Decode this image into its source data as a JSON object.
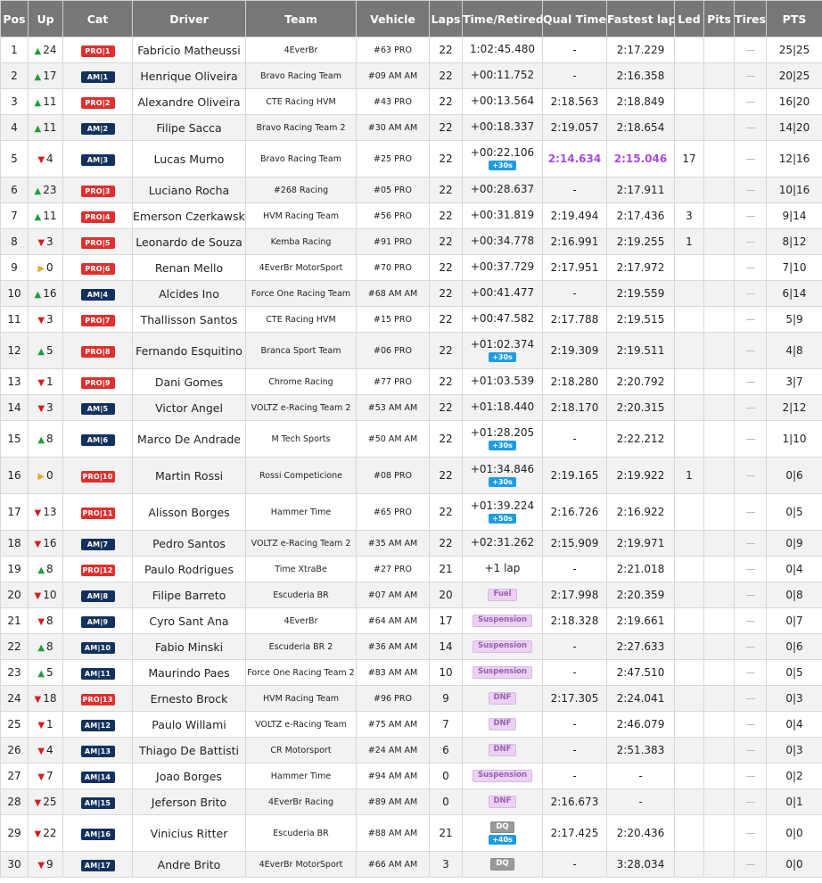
{
  "headers": [
    "Pos",
    "Up",
    "Cat",
    "Driver",
    "Team",
    "Vehicle",
    "Laps",
    "Time/Retired",
    "Qual Time",
    "Fastest lap",
    "Led",
    "Pits",
    "Tires",
    "PTS"
  ],
  "rows": [
    {
      "pos": "1",
      "up_dir": "up",
      "up": "24",
      "cat": "PRO",
      "cat_label": "PRO|1",
      "driver": "Fabricio Matheussi",
      "team": "4EverBr",
      "vehicle": "#63 PRO",
      "laps": "22",
      "time": "1:02:45.480",
      "penalty": "",
      "status": "",
      "status_color": "",
      "qual": "-",
      "fast": "2:17.229",
      "purple": false,
      "led": "",
      "pts": "25|25",
      "h": 29
    },
    {
      "pos": "2",
      "up_dir": "up",
      "up": "17",
      "cat": "AM",
      "cat_label": "AM|1",
      "driver": "Henrique Oliveira",
      "team": "Bravo Racing Team",
      "vehicle": "#09 AM AM",
      "laps": "22",
      "time": "+00:11.752",
      "penalty": "",
      "status": "",
      "status_color": "",
      "qual": "-",
      "fast": "2:16.358",
      "purple": false,
      "led": "",
      "pts": "20|25",
      "h": 29
    },
    {
      "pos": "3",
      "up_dir": "up",
      "up": "11",
      "cat": "PRO",
      "cat_label": "PRO|2",
      "driver": "Alexandre Oliveira",
      "team": "CTE Racing HVM",
      "vehicle": "#43 PRO",
      "laps": "22",
      "time": "+00:13.564",
      "penalty": "",
      "status": "",
      "status_color": "",
      "qual": "2:18.563",
      "fast": "2:18.849",
      "purple": false,
      "led": "",
      "pts": "16|20",
      "h": 29
    },
    {
      "pos": "4",
      "up_dir": "up",
      "up": "11",
      "cat": "AM",
      "cat_label": "AM|2",
      "driver": "Filipe Sacca",
      "team": "Bravo Racing Team 2",
      "vehicle": "#30 AM AM",
      "laps": "22",
      "time": "+00:18.337",
      "penalty": "",
      "status": "",
      "status_color": "",
      "qual": "2:19.057",
      "fast": "2:18.654",
      "purple": false,
      "led": "",
      "pts": "14|20",
      "h": 29
    },
    {
      "pos": "5",
      "up_dir": "down",
      "up": "4",
      "cat": "AM",
      "cat_label": "AM|3",
      "driver": "Lucas Murno",
      "team": "Bravo Racing Team",
      "vehicle": "#25 PRO",
      "laps": "22",
      "time": "+00:22.106",
      "penalty": "+30s",
      "status": "",
      "status_color": "",
      "qual": "2:14.634",
      "fast": "2:15.046",
      "purple": true,
      "led": "17",
      "pts": "12|16",
      "h": 41
    },
    {
      "pos": "6",
      "up_dir": "up",
      "up": "23",
      "cat": "PRO",
      "cat_label": "PRO|3",
      "driver": "Luciano Rocha",
      "team": "#268 Racing",
      "vehicle": "#05 PRO",
      "laps": "22",
      "time": "+00:28.637",
      "penalty": "",
      "status": "",
      "status_color": "",
      "qual": "-",
      "fast": "2:17.911",
      "purple": false,
      "led": "",
      "pts": "10|16",
      "h": 29
    },
    {
      "pos": "7",
      "up_dir": "up",
      "up": "11",
      "cat": "PRO",
      "cat_label": "PRO|4",
      "driver": "Emerson Czerkawski",
      "team": "HVM Racing Team",
      "vehicle": "#56 PRO",
      "laps": "22",
      "time": "+00:31.819",
      "penalty": "",
      "status": "",
      "status_color": "",
      "qual": "2:19.494",
      "fast": "2:17.436",
      "purple": false,
      "led": "3",
      "pts": "9|14",
      "h": 29
    },
    {
      "pos": "8",
      "up_dir": "down",
      "up": "3",
      "cat": "PRO",
      "cat_label": "PRO|5",
      "driver": "Leonardo de Souza",
      "team": "Kemba Racing",
      "vehicle": "#91 PRO",
      "laps": "22",
      "time": "+00:34.778",
      "penalty": "",
      "status": "",
      "status_color": "",
      "qual": "2:16.991",
      "fast": "2:19.255",
      "purple": false,
      "led": "1",
      "pts": "8|12",
      "h": 29
    },
    {
      "pos": "9",
      "up_dir": "same",
      "up": "0",
      "cat": "PRO",
      "cat_label": "PRO|6",
      "driver": "Renan Mello",
      "team": "4EverBr MotorSport",
      "vehicle": "#70 PRO",
      "laps": "22",
      "time": "+00:37.729",
      "penalty": "",
      "status": "",
      "status_color": "",
      "qual": "2:17.951",
      "fast": "2:17.972",
      "purple": false,
      "led": "",
      "pts": "7|10",
      "h": 29
    },
    {
      "pos": "10",
      "up_dir": "up",
      "up": "16",
      "cat": "AM",
      "cat_label": "AM|4",
      "driver": "Alcides Ino",
      "team": "Force One Racing Team",
      "vehicle": "#68 AM AM",
      "laps": "22",
      "time": "+00:41.477",
      "penalty": "",
      "status": "",
      "status_color": "",
      "qual": "-",
      "fast": "2:19.559",
      "purple": false,
      "led": "",
      "pts": "6|14",
      "h": 29
    },
    {
      "pos": "11",
      "up_dir": "down",
      "up": "3",
      "cat": "PRO",
      "cat_label": "PRO|7",
      "driver": "Thallisson Santos",
      "team": "CTE Racing HVM",
      "vehicle": "#15 PRO",
      "laps": "22",
      "time": "+00:47.582",
      "penalty": "",
      "status": "",
      "status_color": "",
      "qual": "2:17.788",
      "fast": "2:19.515",
      "purple": false,
      "led": "",
      "pts": "5|9",
      "h": 29
    },
    {
      "pos": "12",
      "up_dir": "up",
      "up": "5",
      "cat": "PRO",
      "cat_label": "PRO|8",
      "driver": "Fernando Esquitino",
      "team": "Branca Sport Team",
      "vehicle": "#06 PRO",
      "laps": "22",
      "time": "+01:02.374",
      "penalty": "+30s",
      "status": "",
      "status_color": "",
      "qual": "2:19.309",
      "fast": "2:19.511",
      "purple": false,
      "led": "",
      "pts": "4|8",
      "h": 41
    },
    {
      "pos": "13",
      "up_dir": "down",
      "up": "1",
      "cat": "PRO",
      "cat_label": "PRO|9",
      "driver": "Dani Gomes",
      "team": "Chrome Racing",
      "vehicle": "#77 PRO",
      "laps": "22",
      "time": "+01:03.539",
      "penalty": "",
      "status": "",
      "status_color": "",
      "qual": "2:18.280",
      "fast": "2:20.792",
      "purple": false,
      "led": "",
      "pts": "3|7",
      "h": 29
    },
    {
      "pos": "14",
      "up_dir": "down",
      "up": "3",
      "cat": "AM",
      "cat_label": "AM|5",
      "driver": "Victor Angel",
      "team": "VOLTZ e-Racing Team 2",
      "vehicle": "#53 AM AM",
      "laps": "22",
      "time": "+01:18.440",
      "penalty": "",
      "status": "",
      "status_color": "",
      "qual": "2:18.170",
      "fast": "2:20.315",
      "purple": false,
      "led": "",
      "pts": "2|12",
      "h": 29
    },
    {
      "pos": "15",
      "up_dir": "up",
      "up": "8",
      "cat": "AM",
      "cat_label": "AM|6",
      "driver": "Marco De Andrade",
      "team": "M Tech Sports",
      "vehicle": "#50 AM AM",
      "laps": "22",
      "time": "+01:28.205",
      "penalty": "+30s",
      "status": "",
      "status_color": "",
      "qual": "-",
      "fast": "2:22.212",
      "purple": false,
      "led": "",
      "pts": "1|10",
      "h": 41
    },
    {
      "pos": "16",
      "up_dir": "same",
      "up": "0",
      "cat": "PRO",
      "cat_label": "PRO|10",
      "driver": "Martin Rossi",
      "team": "Rossi Competicione",
      "vehicle": "#08 PRO",
      "laps": "22",
      "time": "+01:34.846",
      "penalty": "+30s",
      "status": "",
      "status_color": "",
      "qual": "2:19.165",
      "fast": "2:19.922",
      "purple": false,
      "led": "1",
      "pts": "0|6",
      "h": 41
    },
    {
      "pos": "17",
      "up_dir": "down",
      "up": "13",
      "cat": "PRO",
      "cat_label": "PRO|11",
      "driver": "Alisson Borges",
      "team": "Hammer Time",
      "vehicle": "#65 PRO",
      "laps": "22",
      "time": "+01:39.224",
      "penalty": "+50s",
      "status": "",
      "status_color": "",
      "qual": "2:16.726",
      "fast": "2:16.922",
      "purple": false,
      "led": "",
      "pts": "0|5",
      "h": 41
    },
    {
      "pos": "18",
      "up_dir": "down",
      "up": "16",
      "cat": "AM",
      "cat_label": "AM|7",
      "driver": "Pedro Santos",
      "team": "VOLTZ e-Racing Team 2",
      "vehicle": "#35 AM AM",
      "laps": "22",
      "time": "+02:31.262",
      "penalty": "",
      "status": "",
      "status_color": "",
      "qual": "2:15.909",
      "fast": "2:19.971",
      "purple": false,
      "led": "",
      "pts": "0|9",
      "h": 29
    },
    {
      "pos": "19",
      "up_dir": "up",
      "up": "8",
      "cat": "PRO",
      "cat_label": "PRO|12",
      "driver": "Paulo Rodrigues",
      "team": "Time XtraBe",
      "vehicle": "#27 PRO",
      "laps": "21",
      "time": "+1 lap",
      "penalty": "",
      "status": "",
      "status_color": "",
      "qual": "-",
      "fast": "2:21.018",
      "purple": false,
      "led": "",
      "pts": "0|4",
      "h": 29
    },
    {
      "pos": "20",
      "up_dir": "down",
      "up": "10",
      "cat": "AM",
      "cat_label": "AM|8",
      "driver": "Filipe Barreto",
      "team": "Escuderia BR",
      "vehicle": "#07 AM AM",
      "laps": "20",
      "time": "",
      "penalty": "",
      "status": "Fuel",
      "status_color": "purple",
      "qual": "2:17.998",
      "fast": "2:20.359",
      "purple": false,
      "led": "",
      "pts": "0|8",
      "h": 29
    },
    {
      "pos": "21",
      "up_dir": "down",
      "up": "8",
      "cat": "AM",
      "cat_label": "AM|9",
      "driver": "Cyro Sant Ana",
      "team": "4EverBr",
      "vehicle": "#64 AM AM",
      "laps": "17",
      "time": "",
      "penalty": "",
      "status": "Suspension",
      "status_color": "purple",
      "qual": "2:18.328",
      "fast": "2:19.661",
      "purple": false,
      "led": "",
      "pts": "0|7",
      "h": 29
    },
    {
      "pos": "22",
      "up_dir": "up",
      "up": "8",
      "cat": "AM",
      "cat_label": "AM|10",
      "driver": "Fabio Minski",
      "team": "Escuderia BR 2",
      "vehicle": "#36 AM AM",
      "laps": "14",
      "time": "",
      "penalty": "",
      "status": "Suspension",
      "status_color": "purple",
      "qual": "-",
      "fast": "2:27.633",
      "purple": false,
      "led": "",
      "pts": "0|6",
      "h": 29
    },
    {
      "pos": "23",
      "up_dir": "up",
      "up": "5",
      "cat": "AM",
      "cat_label": "AM|11",
      "driver": "Maurindo Paes",
      "team": "Force One Racing Team 2",
      "vehicle": "#83 AM AM",
      "laps": "10",
      "time": "",
      "penalty": "",
      "status": "Suspension",
      "status_color": "purple",
      "qual": "-",
      "fast": "2:47.510",
      "purple": false,
      "led": "",
      "pts": "0|5",
      "h": 29
    },
    {
      "pos": "24",
      "up_dir": "down",
      "up": "18",
      "cat": "PRO",
      "cat_label": "PRO|13",
      "driver": "Ernesto Brock",
      "team": "HVM Racing Team",
      "vehicle": "#96 PRO",
      "laps": "9",
      "time": "",
      "penalty": "",
      "status": "DNF",
      "status_color": "purple",
      "qual": "2:17.305",
      "fast": "2:24.041",
      "purple": false,
      "led": "",
      "pts": "0|3",
      "h": 29
    },
    {
      "pos": "25",
      "up_dir": "down",
      "up": "1",
      "cat": "AM",
      "cat_label": "AM|12",
      "driver": "Paulo Willami",
      "team": "VOLTZ e-Racing Team",
      "vehicle": "#75 AM AM",
      "laps": "7",
      "time": "",
      "penalty": "",
      "status": "DNF",
      "status_color": "purple",
      "qual": "-",
      "fast": "2:46.079",
      "purple": false,
      "led": "",
      "pts": "0|4",
      "h": 29
    },
    {
      "pos": "26",
      "up_dir": "down",
      "up": "4",
      "cat": "AM",
      "cat_label": "AM|13",
      "driver": "Thiago De Battisti",
      "team": "CR Motorsport",
      "vehicle": "#24 AM AM",
      "laps": "6",
      "time": "",
      "penalty": "",
      "status": "DNF",
      "status_color": "purple",
      "qual": "-",
      "fast": "2:51.383",
      "purple": false,
      "led": "",
      "pts": "0|3",
      "h": 29
    },
    {
      "pos": "27",
      "up_dir": "down",
      "up": "7",
      "cat": "AM",
      "cat_label": "AM|14",
      "driver": "Joao Borges",
      "team": "Hammer Time",
      "vehicle": "#94 AM AM",
      "laps": "0",
      "time": "",
      "penalty": "",
      "status": "Suspension",
      "status_color": "purple",
      "qual": "-",
      "fast": "-",
      "purple": false,
      "led": "",
      "pts": "0|2",
      "h": 29
    },
    {
      "pos": "28",
      "up_dir": "down",
      "up": "25",
      "cat": "AM",
      "cat_label": "AM|15",
      "driver": "Jeferson Brito",
      "team": "4EverBr Racing",
      "vehicle": "#89 AM AM",
      "laps": "0",
      "time": "",
      "penalty": "",
      "status": "DNF",
      "status_color": "purple",
      "qual": "2:16.673",
      "fast": "-",
      "purple": false,
      "led": "",
      "pts": "0|1",
      "h": 29
    },
    {
      "pos": "29",
      "up_dir": "down",
      "up": "22",
      "cat": "AM",
      "cat_label": "AM|16",
      "driver": "Vinicius Ritter",
      "team": "Escuderia BR",
      "vehicle": "#88 AM AM",
      "laps": "21",
      "time": "",
      "penalty": "+40s",
      "status": "DQ",
      "status_color": "gray",
      "qual": "2:17.425",
      "fast": "2:20.436",
      "purple": false,
      "led": "",
      "pts": "0|0",
      "h": 41
    },
    {
      "pos": "30",
      "up_dir": "down",
      "up": "9",
      "cat": "AM",
      "cat_label": "AM|17",
      "driver": "Andre Brito",
      "team": "4EverBr MotorSport",
      "vehicle": "#66 AM AM",
      "laps": "3",
      "time": "",
      "penalty": "",
      "status": "DQ",
      "status_color": "gray",
      "qual": "-",
      "fast": "3:28.034",
      "purple": false,
      "led": "",
      "pts": "0|0",
      "h": 29
    }
  ],
  "colors": {
    "header_bg": "#777777",
    "pro": "#e0302e",
    "am": "#12315e",
    "penalty": "#1e9ee0",
    "purple_time": "#a64ce0",
    "arrow_up": "#1f9d3a",
    "arrow_down": "#d11f1f",
    "arrow_same": "#f0a030"
  }
}
